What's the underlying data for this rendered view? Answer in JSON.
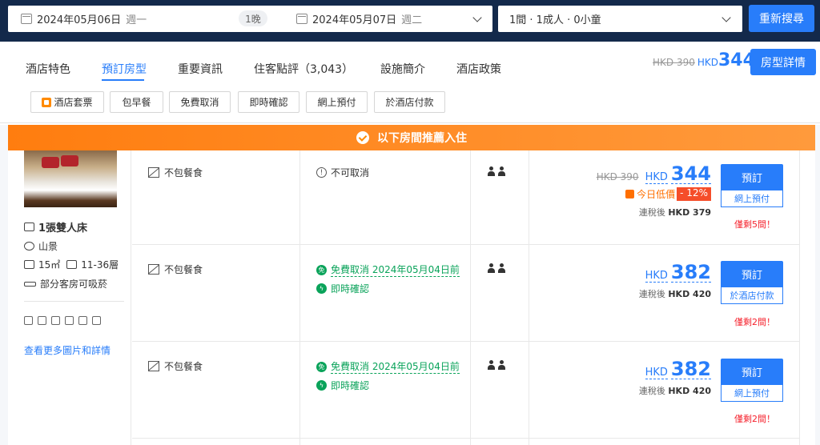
{
  "search": {
    "checkin_date": "2024年05月06日",
    "checkin_weekday": "週一",
    "nights": "1晚",
    "checkout_date": "2024年05月07日",
    "checkout_weekday": "週二",
    "guests": "1間 · 1成人 · 0小童",
    "search_button": "重新搜尋"
  },
  "nav": {
    "tabs": [
      {
        "label": "酒店特色"
      },
      {
        "label": "預訂房型"
      },
      {
        "label": "重要資訊"
      },
      {
        "label": "住客點評（3,043）"
      },
      {
        "label": "設施簡介"
      },
      {
        "label": "酒店政策"
      }
    ],
    "price_old": "HKD 390",
    "price_currency": "HKD",
    "price_value": "344",
    "detail_button": "房型詳情"
  },
  "filters": [
    "酒店套票",
    "包早餐",
    "免費取消",
    "即時確認",
    "網上預付",
    "於酒店付款"
  ],
  "banner": {
    "text": "以下房間推薦入住"
  },
  "room": {
    "bed": "1張雙人床",
    "view": "山景",
    "size": "15㎡",
    "floor": "11-36層",
    "smoking": "部分客房可吸菸",
    "more_link": "查看更多圖片和詳情"
  },
  "rates": [
    {
      "meal": "不包餐食",
      "cancel": "不可取消",
      "price_old": "HKD 390",
      "currency": "HKD",
      "price": "344",
      "low_tag": "今日低價",
      "discount": "- 12%",
      "tax_label": "連稅後",
      "tax_price": "HKD 379",
      "book": "預訂",
      "pay": "網上預付",
      "left": "僅剩5間！"
    },
    {
      "meal": "不包餐食",
      "cancel": "免費取消 2024年05月04日前",
      "confirm": "即時確認",
      "currency": "HKD",
      "price": "382",
      "tax_label": "連稅後",
      "tax_price": "HKD 420",
      "book": "預訂",
      "pay": "於酒店付款",
      "left": "僅剩2間！"
    },
    {
      "meal": "不包餐食",
      "cancel": "免費取消 2024年05月04日前",
      "confirm": "即時確認",
      "currency": "HKD",
      "price": "382",
      "tax_label": "連稅後",
      "tax_price": "HKD 420",
      "book": "預訂",
      "pay": "網上預付",
      "left": "僅剩2間！"
    }
  ]
}
